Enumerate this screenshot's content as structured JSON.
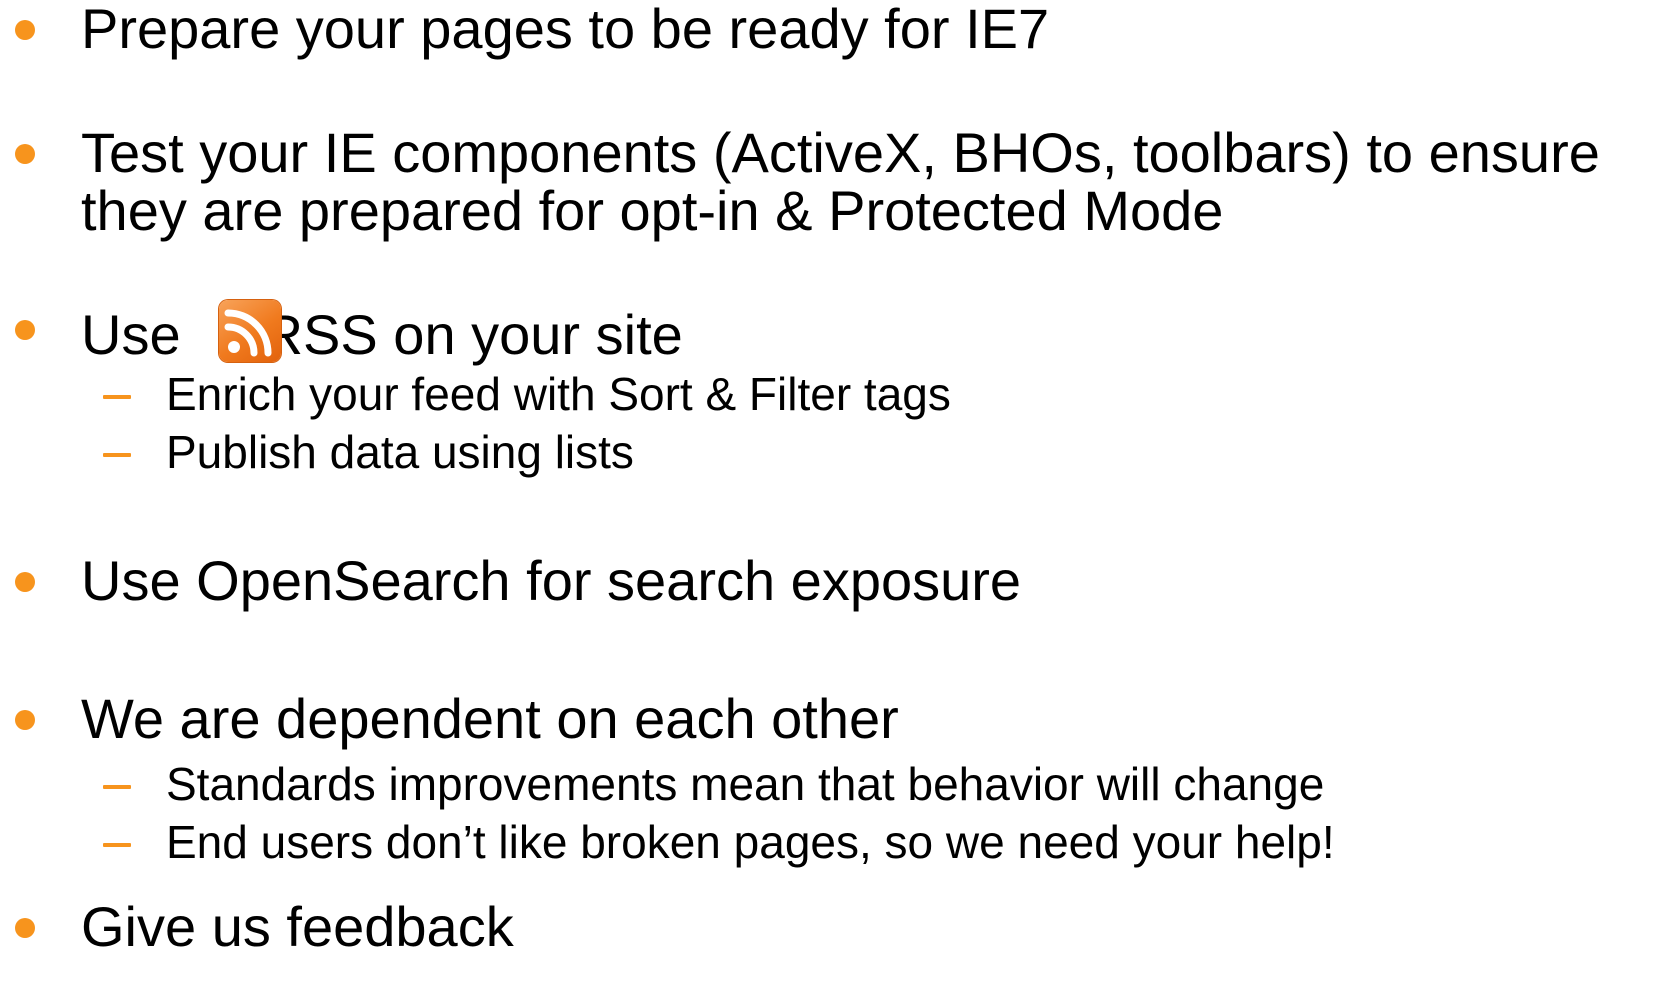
{
  "bullets": [
    {
      "text": "Prepare your pages to be ready for IE7"
    },
    {
      "lines": [
        "Test your IE components (ActiveX, BHOs, toolbars) to ensure",
        "they are prepared for opt-in & Protected Mode"
      ]
    },
    {
      "prefix": "Use",
      "text": "RSS on your site",
      "icon": "rss-feed-icon",
      "subitems": [
        "Enrich your feed with Sort & Filter tags",
        "Publish data using lists"
      ]
    },
    {
      "text": "Use OpenSearch for search exposure"
    },
    {
      "text": "We are dependent on each other",
      "subitems": [
        "Standards improvements mean that behavior will change",
        "End users don’t like broken pages, so we need your help!"
      ]
    },
    {
      "text": "Give us feedback"
    }
  ],
  "colors": {
    "bullet": "#f7941d",
    "rss_icon": "#f07a1e",
    "text": "#000000"
  }
}
